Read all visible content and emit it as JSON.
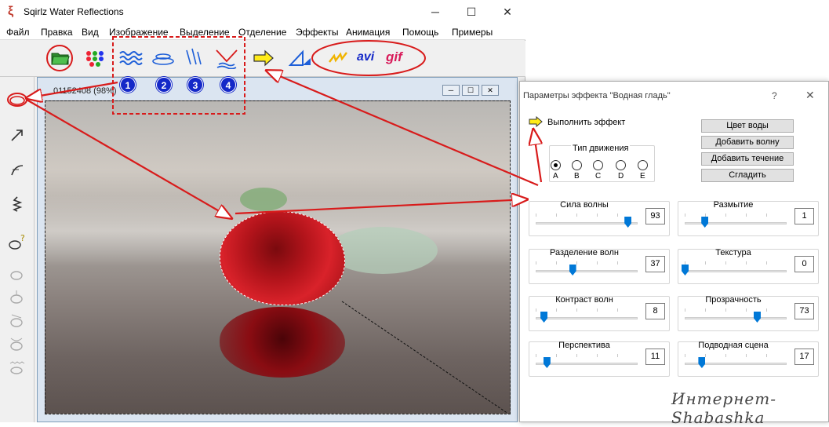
{
  "app": {
    "title": "Sqirlz Water Reflections",
    "icon": "squirrel-icon",
    "window_controls": [
      "─",
      "☐",
      "✕"
    ]
  },
  "menu": [
    "Файл",
    "Правка",
    "Вид",
    "Изображение",
    "Выделение",
    "Отделение",
    "Эффекты",
    "Анимация",
    "Помощь",
    "Примеры"
  ],
  "toolbar": {
    "open_icon": "open-folder-icon",
    "palette_icon": "dots-palette-icon",
    "effects": [
      "waves-effect-icon",
      "ripple-effect-icon",
      "rain-effect-icon",
      "flow-effect-icon"
    ],
    "run_icon": "run-arrow-icon",
    "triangle_icon": "perspective-triangle-icon",
    "anim_label": "avi",
    "gif_label": "gif"
  },
  "badges": [
    "1",
    "2",
    "3",
    "4"
  ],
  "child_window": {
    "title": "01152408  (98%)",
    "controls": [
      "─",
      "☐",
      "✕"
    ]
  },
  "dialog": {
    "title": "Параметры эффекта \"Водная гладь\"",
    "help": "?",
    "close": "✕",
    "run_label": "Выполнить эффект",
    "buttons": [
      "Цвет воды",
      "Добавить волну",
      "Добавить течение",
      "Сгладить"
    ],
    "motion_type": {
      "label": "Тип движения",
      "options": [
        "A",
        "B",
        "C",
        "D",
        "E"
      ],
      "selected": "A"
    },
    "sliders": [
      {
        "label": "Сила волны",
        "value": "93",
        "level": 0.93
      },
      {
        "label": "Размытие",
        "value": "1",
        "level": 0.2
      },
      {
        "label": "Разделение волн",
        "value": "37",
        "level": 0.37
      },
      {
        "label": "Текстура",
        "value": "0",
        "level": 0.0
      },
      {
        "label": "Контраст волн",
        "value": "8",
        "level": 0.08
      },
      {
        "label": "Прозрачность",
        "value": "73",
        "level": 0.73
      },
      {
        "label": "Перспектива",
        "value": "11",
        "level": 0.11
      },
      {
        "label": "Подводная сцена",
        "value": "17",
        "level": 0.17
      }
    ]
  },
  "watermark": "Интернет-Shabashka",
  "colors": {
    "annotation": "#d81b1b",
    "badge": "#1428c8",
    "slider_thumb": "#0078d7"
  }
}
